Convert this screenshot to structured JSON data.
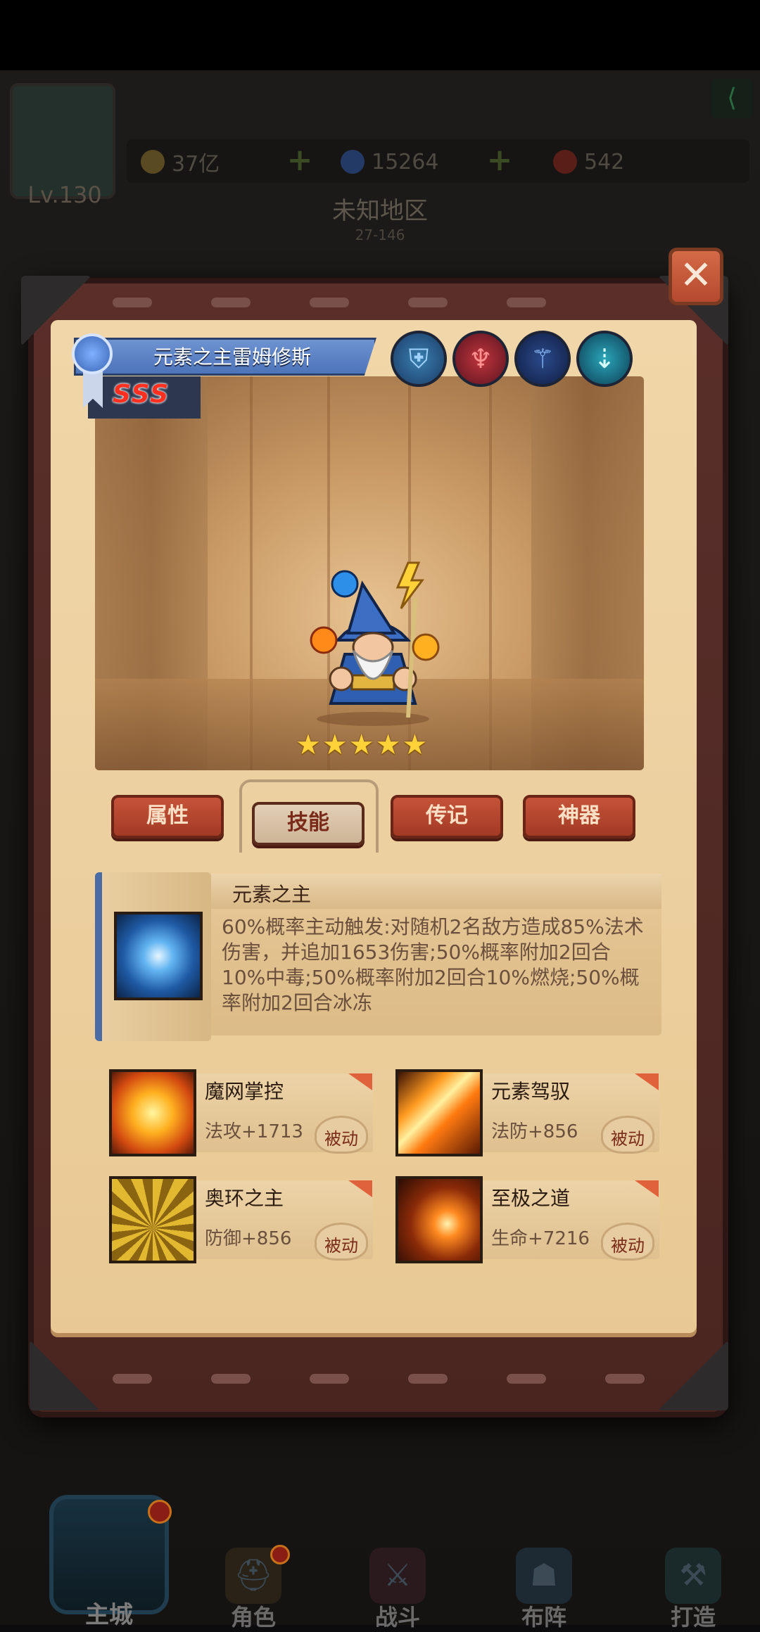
{
  "background": {
    "level": "Lv.130",
    "resources": [
      {
        "name": "gold",
        "value": "37亿",
        "color": "#d9a441"
      },
      {
        "name": "diamond",
        "value": "15264",
        "color": "#4b74d6"
      },
      {
        "name": "ruby",
        "value": "542",
        "color": "#c0392b"
      }
    ],
    "region_name": "未知地区",
    "region_code": "27-146"
  },
  "hero": {
    "name": "元素之主雷姆修斯",
    "grade": "SSS",
    "stars": 5,
    "star_glyph": "★",
    "element_icons": [
      "helmet-icon",
      "demon-mask-icon",
      "staff-icon",
      "wave-icon"
    ]
  },
  "tabs": [
    {
      "label": "属性",
      "active": false
    },
    {
      "label": "技能",
      "active": true
    },
    {
      "label": "传记",
      "active": false
    },
    {
      "label": "神器",
      "active": false
    }
  ],
  "main_skill": {
    "title": "元素之主",
    "description": "60%概率主动触发:对随机2名敌方造成85%法术伤害，并追加1653伤害;50%概率附加2回合10%中毒;50%概率附加2回合10%燃烧;50%概率附加2回合冰冻"
  },
  "passive_skills": [
    {
      "name": "魔网掌控",
      "stat": "法攻+1713",
      "badge": "被动"
    },
    {
      "name": "元素驾驭",
      "stat": "法防+856",
      "badge": "被动"
    },
    {
      "name": "奥环之主",
      "stat": "防御+856",
      "badge": "被动"
    },
    {
      "name": "至极之道",
      "stat": "生命+7216",
      "badge": "被动"
    }
  ],
  "close_glyph": "✕",
  "nav": [
    {
      "label": "主城"
    },
    {
      "label": "角色"
    },
    {
      "label": "战斗"
    },
    {
      "label": "布阵"
    },
    {
      "label": "打造"
    }
  ]
}
